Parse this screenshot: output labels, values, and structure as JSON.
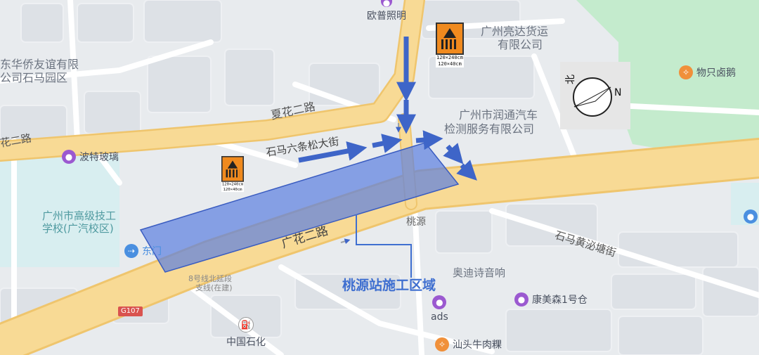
{
  "map": {
    "roads": {
      "xiahua": "夏花二路",
      "guanghua": "广花二路",
      "shima_lane": "石马六条松大街",
      "shima_huang": "石马黄泌塘街",
      "huahua_left": "花二路",
      "taoyuan": "桃源"
    },
    "areas": {
      "liangda_1": "广州亮达货运",
      "liangda_2": "有限公司",
      "huaqiao_1": "东华侨友谊有限",
      "huaqiao_2": "公司石马园区",
      "runtong_1": "广州市润通汽车",
      "runtong_2": "检测服务有限公司",
      "school_1": "广州市高级技工",
      "school_2": "学校(广汽校区)",
      "aodi": "奥迪诗音响",
      "metro_1": "8号线北延段",
      "metro_2": "支线(在建)"
    },
    "pois": {
      "oupu": "欧普照明",
      "wuzhi": "物只卤鹅",
      "bote": "波特玻璃",
      "dongmen": "东门",
      "kangmei": "康美森1号仓",
      "ads": "ads",
      "sinopec": "中国石化",
      "shantou": "汕头牛肉粿"
    },
    "shields": {
      "g107": "G107"
    },
    "construction_label": "桃源站施工区域",
    "signs": [
      {
        "dim_1": "120×240cm",
        "dim_2": "120×40cm"
      },
      {
        "dim_1": "120×240cm",
        "dim_2": "120×40cm"
      }
    ],
    "compass": {
      "north_char": "北",
      "n_letter": "N"
    },
    "colors": {
      "road": "#f7d58e",
      "road_edge": "#efc56d",
      "construction": "#4f73d9",
      "arrow": "#3e65c8",
      "green": "#bfe8c8",
      "building": "#dfe2e7",
      "label_blue": "#3f6fd0"
    }
  }
}
